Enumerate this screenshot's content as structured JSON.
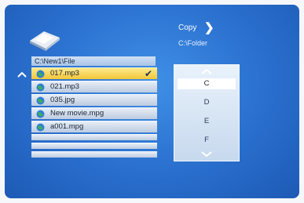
{
  "browser": {
    "current_path": "C:\\New1\\File",
    "files": [
      {
        "name": "017.mp3",
        "selected": true,
        "checked": true
      },
      {
        "name": "021.mp3",
        "selected": false,
        "checked": false
      },
      {
        "name": "035.jpg",
        "selected": false,
        "checked": false
      },
      {
        "name": "New movie.mpg",
        "selected": false,
        "checked": false
      },
      {
        "name": "a001.mpg",
        "selected": false,
        "checked": false
      }
    ],
    "check_glyph": "✔"
  },
  "action": {
    "label": "Copy",
    "chevron": "❯",
    "destination": "C:\\Folder"
  },
  "drives": {
    "items": [
      "C",
      "D",
      "E",
      "F"
    ],
    "selected": "C"
  },
  "colors": {
    "background": "#2a6fce",
    "selection": "#f1c63a",
    "panel": "#d8e6f4"
  },
  "icons": {
    "folder": "folder-icon",
    "file": "globe-icon",
    "scroll_up": "arrow-up-icon",
    "scroll_down": "arrow-down-icon"
  }
}
